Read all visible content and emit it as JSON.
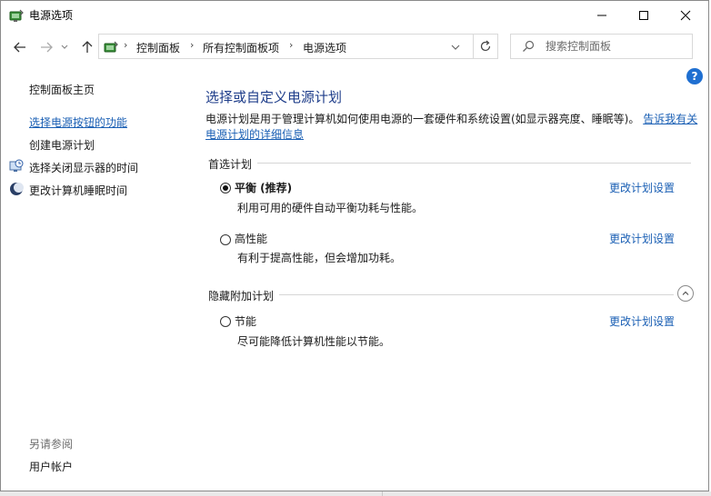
{
  "window": {
    "title": "电源选项"
  },
  "address": {
    "crumbs": [
      "控制面板",
      "所有控制面板项",
      "电源选项"
    ],
    "search_placeholder": "搜索控制面板"
  },
  "left_nav": {
    "home": "控制面板主页",
    "items": [
      "选择电源按钮的功能",
      "创建电源计划",
      "选择关闭显示器的时间",
      "更改计算机睡眠时间"
    ],
    "see_also_title": "另请参阅",
    "see_also_items": [
      "用户帐户"
    ]
  },
  "main": {
    "title": "选择或自定义电源计划",
    "intro_text": "电源计划是用于管理计算机如何使用电源的一套硬件和系统设置(如显示器亮度、睡眠等)。",
    "intro_link": "告诉我有关电源计划的详细信息",
    "preferred_header": "首选计划",
    "hidden_header": "隐藏附加计划",
    "change_link": "更改计划设置",
    "plans": [
      {
        "name": "平衡 (推荐)",
        "desc": "利用可用的硬件自动平衡功耗与性能。",
        "selected": true
      },
      {
        "name": "高性能",
        "desc": "有利于提高性能，但会增加功耗。",
        "selected": false
      },
      {
        "name": "节能",
        "desc": "尽可能降低计算机性能以节能。",
        "selected": false
      }
    ]
  },
  "colors": {
    "link": "#1a5fb4",
    "title": "#1e3d8a",
    "help": "#1f6fd1"
  },
  "icons": [
    "power-options-icon",
    "minimize-icon",
    "maximize-icon",
    "close-icon",
    "back-arrow-icon",
    "forward-arrow-icon",
    "recent-dropdown-icon",
    "up-arrow-icon",
    "chevron-right-icon",
    "chevron-down-icon",
    "refresh-icon",
    "search-icon",
    "help-icon",
    "clock-monitor-icon",
    "moon-icon",
    "chevron-up-icon"
  ]
}
